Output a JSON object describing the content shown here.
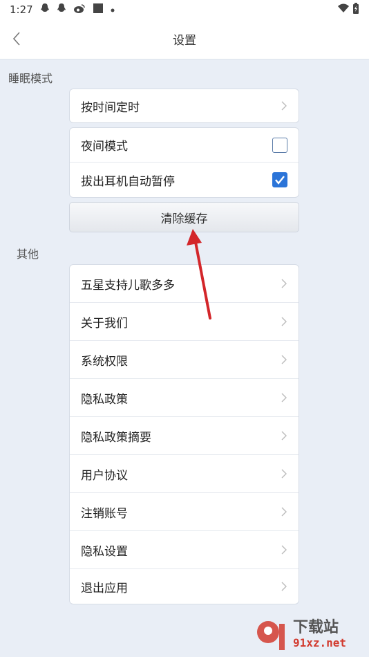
{
  "status_bar": {
    "time": "1:27",
    "icons": [
      "qq-icon",
      "qq-icon",
      "weibo-icon",
      "app-icon",
      "dot-icon",
      "wifi-icon",
      "battery-icon"
    ]
  },
  "header": {
    "title": "设置",
    "back_icon": "chevron-left-icon"
  },
  "sleep_section": {
    "label": "睡眠模式",
    "timer_row": {
      "label": "按时间定时"
    },
    "night_mode": {
      "label": "夜间模式",
      "checked": false
    },
    "auto_pause": {
      "label": "拔出耳机自动暂停",
      "checked": true
    }
  },
  "clear_cache": {
    "label": "清除缓存"
  },
  "other_section": {
    "label": "其他",
    "items": [
      {
        "label": "五星支持儿歌多多"
      },
      {
        "label": "关于我们"
      },
      {
        "label": "系统权限"
      },
      {
        "label": "隐私政策"
      },
      {
        "label": "隐私政策摘要"
      },
      {
        "label": "用户协议"
      },
      {
        "label": "注销账号"
      },
      {
        "label": "隐私设置"
      },
      {
        "label": "退出应用"
      }
    ]
  },
  "colors": {
    "accent": "#2b74d8",
    "arrow": "#d3262a",
    "background": "#e9eef6"
  },
  "watermark": {
    "main": "下载站",
    "sub": "91xz.net"
  }
}
